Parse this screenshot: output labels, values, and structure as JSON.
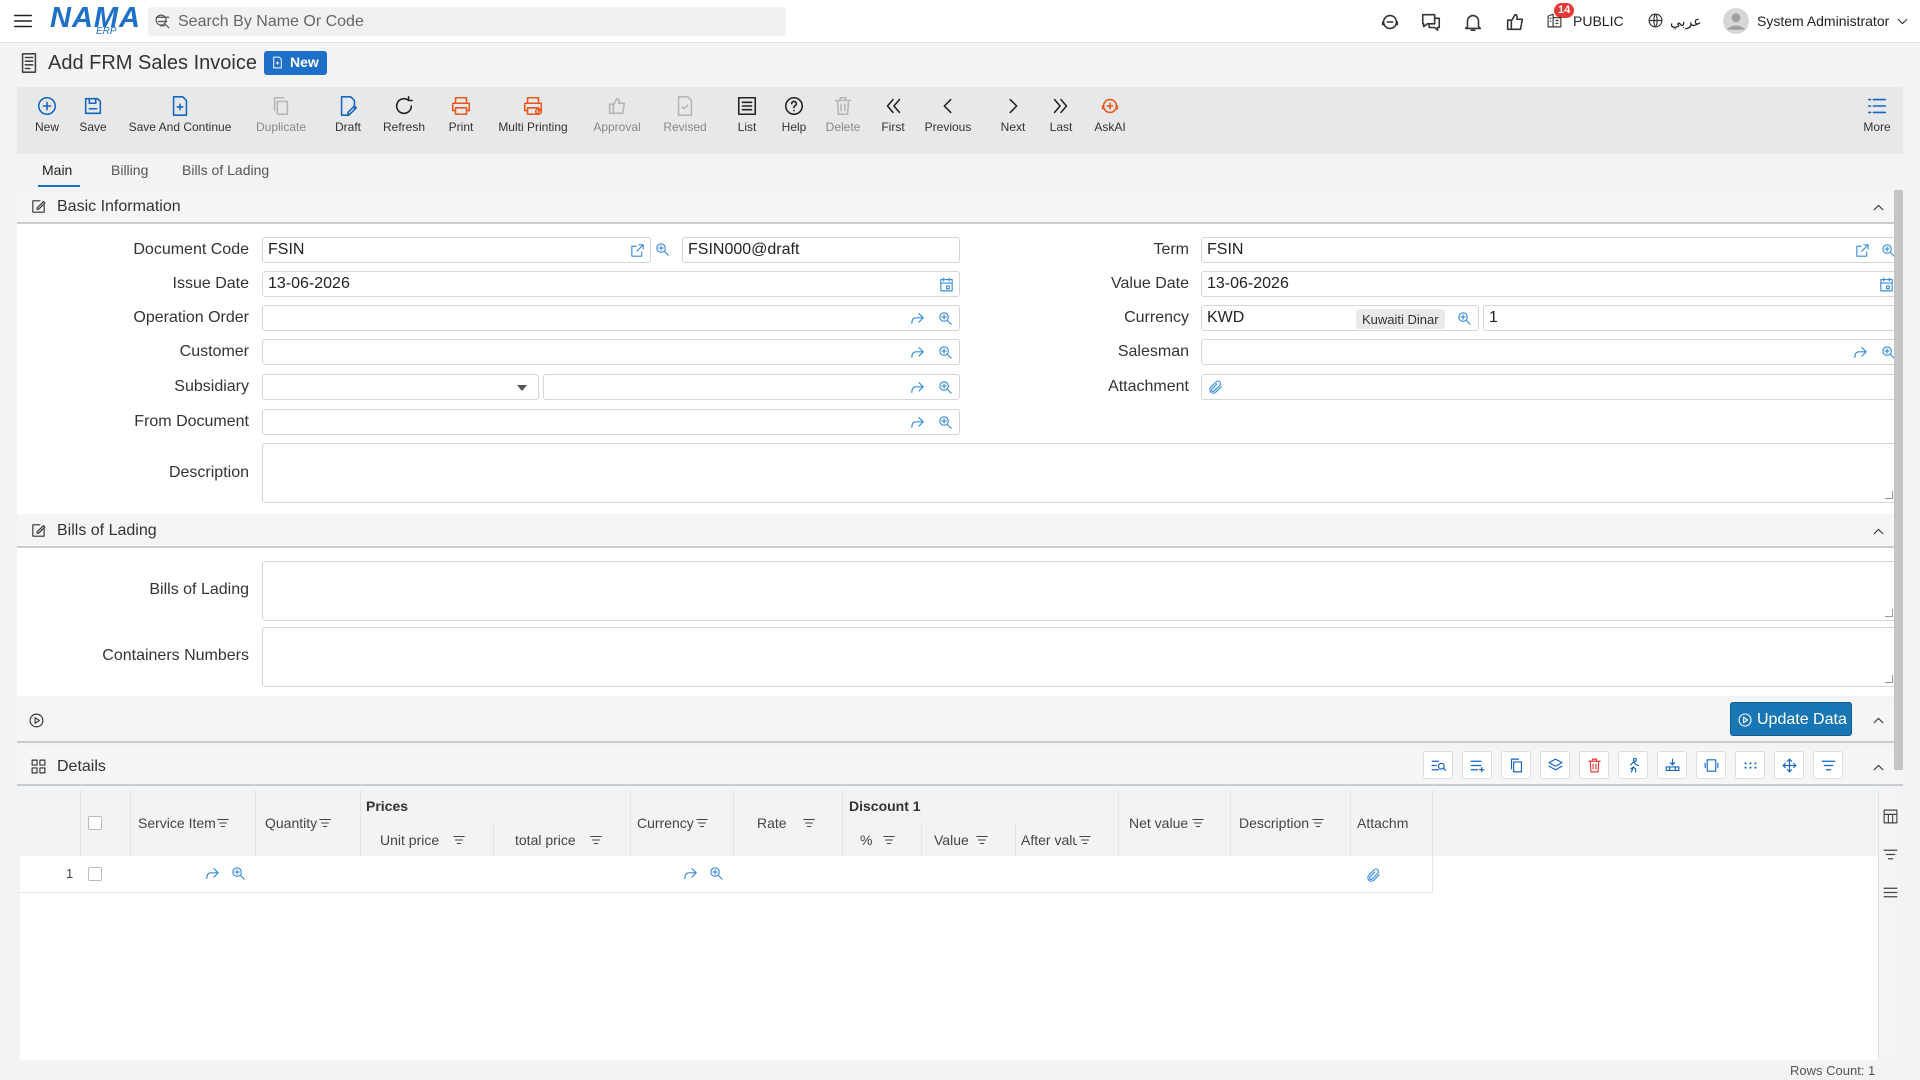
{
  "topbar": {
    "logo_text": "NAMA",
    "logo_sub": "ERP",
    "search_placeholder": "Search By Name Or Code",
    "notification_count": "14",
    "scope": "PUBLIC",
    "language": "عربي",
    "user_name": "System Administrator"
  },
  "page": {
    "title": "Add FRM Sales Invoice",
    "status_badge": "New"
  },
  "toolbar": {
    "new": "New",
    "save": "Save",
    "save_continue": "Save And Continue",
    "duplicate": "Duplicate",
    "draft": "Draft",
    "refresh": "Refresh",
    "print": "Print",
    "multi_printing": "Multi Printing",
    "approval": "Approval",
    "revised": "Revised",
    "list": "List",
    "help": "Help",
    "delete": "Delete",
    "first": "First",
    "previous": "Previous",
    "next": "Next",
    "last": "Last",
    "askai": "AskAI",
    "more": "More"
  },
  "tabs": [
    "Main",
    "Billing",
    "Bills of Lading"
  ],
  "basic_info": {
    "title": "Basic Information",
    "labels": {
      "document_code": "Document Code",
      "issue_date": "Issue Date",
      "operation_order": "Operation Order",
      "customer": "Customer",
      "subsidiary": "Subsidiary",
      "from_document": "From Document",
      "description": "Description",
      "term": "Term",
      "value_date": "Value Date",
      "currency": "Currency",
      "salesman": "Salesman",
      "attachment": "Attachment"
    },
    "values": {
      "document_code": "FSIN",
      "document_number": "FSIN000@draft",
      "issue_date": "13-06-2026",
      "term": "FSIN",
      "value_date": "13-06-2026",
      "currency_code": "KWD",
      "currency_name": "Kuwaiti Dinar",
      "currency_rate": "1"
    }
  },
  "bills_section": {
    "title": "Bills of Lading",
    "labels": {
      "bills_of_lading": "Bills of Lading",
      "containers_numbers": "Containers Numbers"
    }
  },
  "update_button": "Update Data",
  "details": {
    "title": "Details",
    "columns": {
      "service_item": "Service Item",
      "quantity": "Quantity",
      "prices": "Prices",
      "unit_price": "Unit price",
      "total_price": "total price",
      "currency": "Currency",
      "rate": "Rate",
      "discount": "Discount 1",
      "percent": "%",
      "value": "Value",
      "after_value": "After valu",
      "net_value": "Net value",
      "description": "Description",
      "attachment": "Attachm"
    },
    "rows": [
      {
        "index": "1"
      }
    ],
    "footer": "Rows Count: 1"
  }
}
